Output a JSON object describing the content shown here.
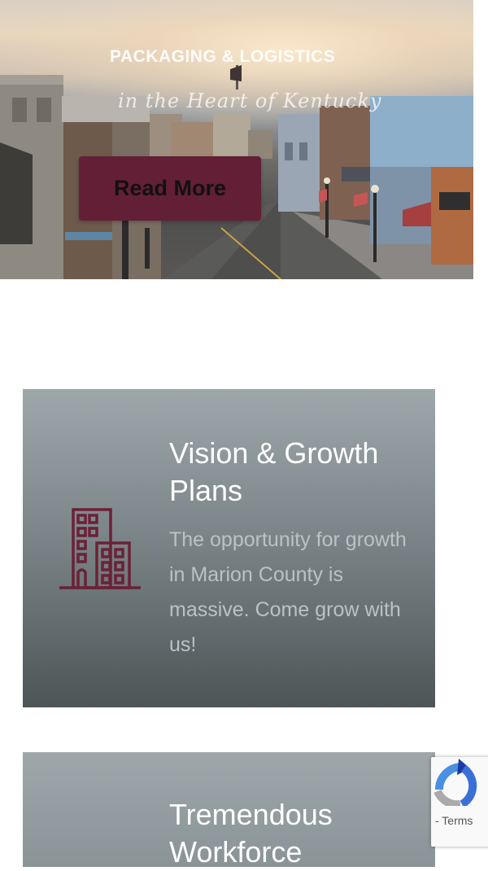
{
  "hero": {
    "tagline": "PACKAGING & LOGISTICS",
    "script_text": "in the Heart of Kentucky",
    "read_more_label": "Read More"
  },
  "cards": [
    {
      "title": "Vision & Growth Plans",
      "body": "The opportunity for growth in Marion County is massive. Come grow with us!",
      "icon": "building-icon"
    },
    {
      "title": "Tremendous Workforce"
    }
  ],
  "recaptcha": {
    "terms_label": "- Terms"
  },
  "colors": {
    "brand_maroon": "#621f36",
    "icon_maroon": "#6b2136",
    "card_text": "#ffffff",
    "card_body_text": "#bbc2c4"
  }
}
